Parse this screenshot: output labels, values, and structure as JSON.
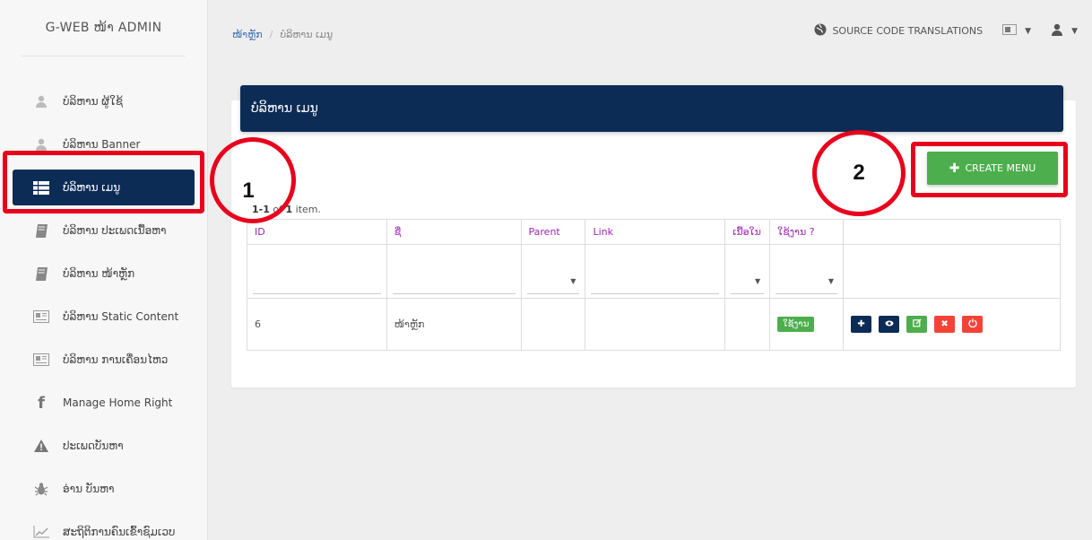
{
  "brand": "G-WEB ໜ້າ ADMIN",
  "sidebar": {
    "items": [
      {
        "label": "ບໍລິຫານ ຜູ້ໃຊ້",
        "icon": "user-icon"
      },
      {
        "label": "ບໍລິຫານ Banner",
        "icon": "user-icon"
      },
      {
        "label": "ບໍລິຫານ ເມນູ",
        "icon": "table-icon"
      },
      {
        "label": "ບໍລິຫານ ປະເພດເນື້ອຫາ",
        "icon": "book-icon"
      },
      {
        "label": "ບໍລິຫານ ໜ້າຫຼັກ",
        "icon": "book-icon"
      },
      {
        "label": "ບໍລິຫານ Static Content",
        "icon": "newspaper-icon"
      },
      {
        "label": "ບໍລິຫານ ການເຄື່ອນໄຫວ",
        "icon": "newspaper-icon"
      },
      {
        "label": "Manage Home Right",
        "icon": "facebook-icon"
      },
      {
        "label": "ປະເພດບັນຫາ",
        "icon": "warning-icon"
      },
      {
        "label": "ອ່ານ ບັນຫາ",
        "icon": "bug-icon"
      },
      {
        "label": "ສະຖິຕິການຄົນເຂົ້າຊົມເວບ",
        "icon": "chart-icon"
      }
    ]
  },
  "breadcrumb": {
    "home": "ໜ້າຫຼັກ",
    "current": "ບໍລິຫານ ເມນູ"
  },
  "topbar": {
    "source_link": "SOURCE CODE TRANSLATIONS"
  },
  "card": {
    "title": "ບໍລິຫານ ເມນູ",
    "create_button": "CREATE MENU"
  },
  "summary": {
    "range": "1-1",
    "of": "of",
    "total": "1",
    "suffix": "item."
  },
  "table": {
    "headers": [
      "ID",
      "ຊື່",
      "Parent",
      "Link",
      "ເນື້ອໃນ",
      "ໃຊ້ງານ ?"
    ],
    "rows": [
      {
        "id": "6",
        "name": "ໜ້າຫຼັກ",
        "parent": "",
        "link": "",
        "content": "",
        "status": "ໃຊ້ງານ"
      }
    ]
  },
  "annotations": {
    "marker1": "1",
    "marker2": "2"
  },
  "colors": {
    "navy": "#0c2c56",
    "green": "#4cae4c",
    "red": "#f44336",
    "annotation": "#e8001c"
  }
}
